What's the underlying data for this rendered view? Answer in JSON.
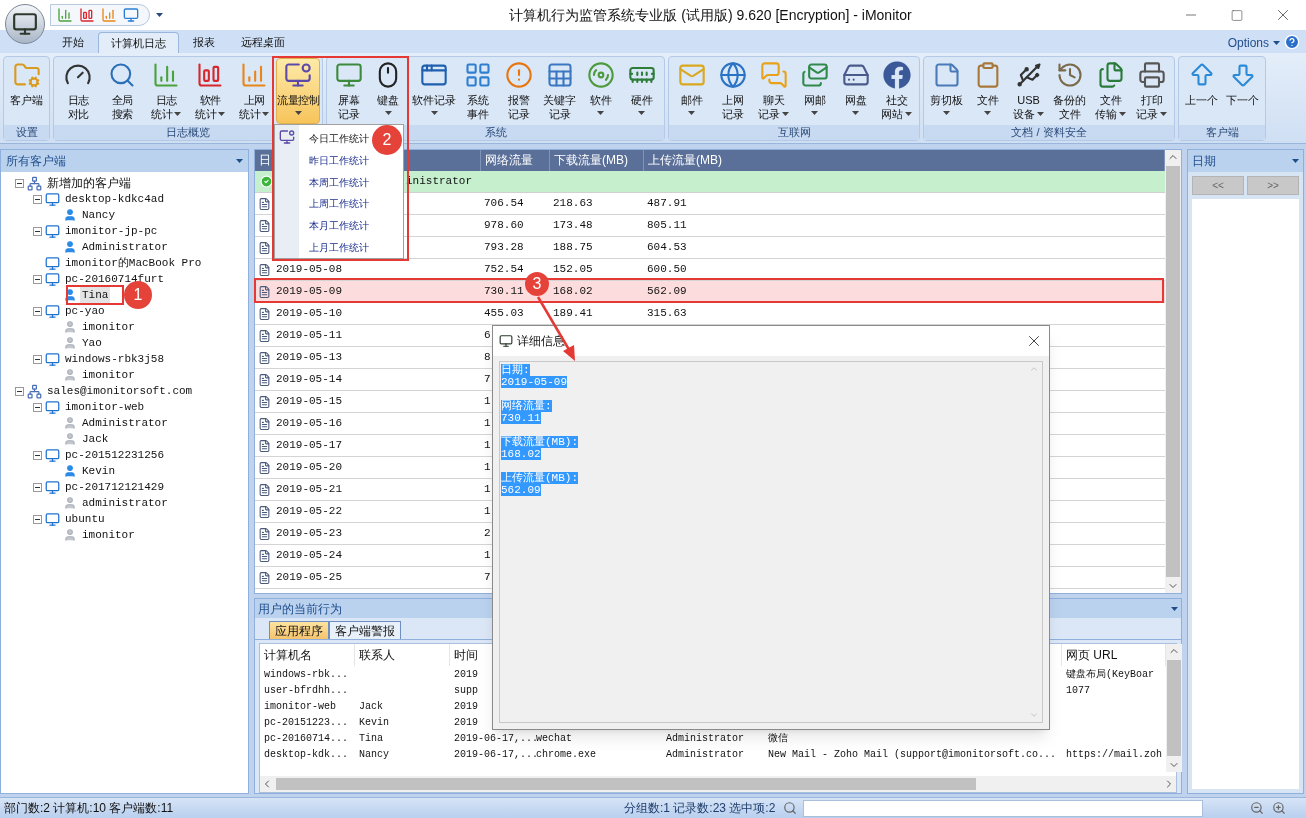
{
  "window": {
    "title": "计算机行为监管系统专业版 (试用版) 9.620 [Encryption] - iMonitor"
  },
  "ribbon_tabs": [
    {
      "label": "开始",
      "selected": false
    },
    {
      "label": "计算机日志",
      "selected": true
    },
    {
      "label": "报表",
      "selected": false
    },
    {
      "label": "远程桌面",
      "selected": false
    }
  ],
  "options": "Options",
  "ribbon_groups": [
    {
      "label": "设置",
      "buttons": [
        {
          "lines": [
            "客户端"
          ],
          "dropdown": false,
          "pressed": false
        }
      ]
    },
    {
      "label": "日志概览",
      "buttons": [
        {
          "lines": [
            "日志",
            "对比"
          ],
          "dropdown": false,
          "pressed": false
        },
        {
          "lines": [
            "全局",
            "搜索"
          ],
          "dropdown": false,
          "pressed": false
        },
        {
          "lines": [
            "日志",
            "统计"
          ],
          "dropdown": true,
          "pressed": false
        },
        {
          "lines": [
            "软件",
            "统计"
          ],
          "dropdown": true,
          "pressed": false
        },
        {
          "lines": [
            "上网",
            "统计"
          ],
          "dropdown": true,
          "pressed": false
        },
        {
          "lines": [
            "流量控制"
          ],
          "dropdown": true,
          "pressed": true
        }
      ]
    },
    {
      "label": "系统",
      "buttons": [
        {
          "lines": [
            "屏幕",
            "记录"
          ],
          "dropdown": false,
          "pressed": false
        },
        {
          "lines": [
            "键盘"
          ],
          "dropdown": true,
          "pressed": false
        },
        {
          "lines": [
            "软件记录"
          ],
          "dropdown": true,
          "pressed": false
        },
        {
          "lines": [
            "系统",
            "事件"
          ],
          "dropdown": false,
          "pressed": false
        },
        {
          "lines": [
            "报警",
            "记录"
          ],
          "dropdown": false,
          "pressed": false
        },
        {
          "lines": [
            "关键字",
            "记录"
          ],
          "dropdown": false,
          "pressed": false
        },
        {
          "lines": [
            "软件"
          ],
          "dropdown": true,
          "pressed": false
        },
        {
          "lines": [
            "硬件"
          ],
          "dropdown": true,
          "pressed": false
        }
      ]
    },
    {
      "label": "互联网",
      "buttons": [
        {
          "lines": [
            "邮件"
          ],
          "dropdown": true,
          "pressed": false
        },
        {
          "lines": [
            "上网",
            "记录"
          ],
          "dropdown": false,
          "pressed": false
        },
        {
          "lines": [
            "聊天",
            "记录"
          ],
          "dropdown": true,
          "pressed": false
        },
        {
          "lines": [
            "网邮"
          ],
          "dropdown": true,
          "pressed": false
        },
        {
          "lines": [
            "网盘"
          ],
          "dropdown": true,
          "pressed": false
        },
        {
          "lines": [
            "社交",
            "网站"
          ],
          "dropdown": true,
          "pressed": false
        }
      ]
    },
    {
      "label": "文档 / 资料安全",
      "buttons": [
        {
          "lines": [
            "剪切板"
          ],
          "dropdown": true,
          "pressed": false
        },
        {
          "lines": [
            "文件"
          ],
          "dropdown": true,
          "pressed": false
        },
        {
          "lines": [
            "USB",
            "设备"
          ],
          "dropdown": true,
          "pressed": false
        },
        {
          "lines": [
            "备份的",
            "文件"
          ],
          "dropdown": false,
          "pressed": false
        },
        {
          "lines": [
            "文件",
            "传输"
          ],
          "dropdown": true,
          "pressed": false
        },
        {
          "lines": [
            "打印",
            "记录"
          ],
          "dropdown": true,
          "pressed": false
        }
      ]
    },
    {
      "label": "客户端",
      "buttons": [
        {
          "lines": [
            "上一个"
          ],
          "dropdown": false,
          "pressed": false
        },
        {
          "lines": [
            "下一个"
          ],
          "dropdown": false,
          "pressed": false
        }
      ]
    }
  ],
  "traffic_menu": {
    "items": [
      "今日工作统计",
      "昨日工作统计",
      "本周工作统计",
      "上周工作统计",
      "本月工作统计",
      "上月工作统计"
    ]
  },
  "left_panel": {
    "title": "所有客户端",
    "tree": [
      {
        "kind": "group",
        "label": "新增加的客户端",
        "expanded": true,
        "selected": false,
        "children": [
          {
            "kind": "computer",
            "label": "desktop-kdkc4ad",
            "expanded": true,
            "selected": false,
            "children": [
              {
                "kind": "user",
                "label": "Nancy",
                "online": true,
                "selected": false
              }
            ]
          },
          {
            "kind": "computer",
            "label": "imonitor-jp-pc",
            "expanded": true,
            "selected": false,
            "children": [
              {
                "kind": "user",
                "label": "Administrator",
                "online": true,
                "selected": false
              }
            ]
          },
          {
            "kind": "computer",
            "label": "imonitor的MacBook Pro",
            "selected": false
          },
          {
            "kind": "computer",
            "label": "pc-20160714furt",
            "expanded": true,
            "selected": false,
            "children": [
              {
                "kind": "user",
                "label": "Tina",
                "online": true,
                "selected": true
              }
            ]
          },
          {
            "kind": "computer",
            "label": "pc-yao",
            "expanded": true,
            "selected": false,
            "children": [
              {
                "kind": "user",
                "label": "imonitor",
                "online": false,
                "selected": false
              },
              {
                "kind": "user",
                "label": "Yao",
                "online": false,
                "selected": false
              }
            ]
          },
          {
            "kind": "computer",
            "label": "windows-rbk3j58",
            "expanded": true,
            "selected": false,
            "children": [
              {
                "kind": "user",
                "label": "imonitor",
                "online": false,
                "selected": false
              }
            ]
          }
        ]
      },
      {
        "kind": "group",
        "label": "sales@imonitorsoft.com",
        "expanded": true,
        "selected": false,
        "children": [
          {
            "kind": "computer",
            "label": "imonitor-web",
            "expanded": true,
            "selected": false,
            "children": [
              {
                "kind": "user",
                "label": "Administrator",
                "online": false,
                "selected": false
              },
              {
                "kind": "user",
                "label": "Jack",
                "online": false,
                "selected": false
              }
            ]
          },
          {
            "kind": "computer",
            "label": "pc-201512231256",
            "expanded": true,
            "selected": false,
            "children": [
              {
                "kind": "user",
                "label": "Kevin",
                "online": true,
                "selected": false
              }
            ]
          },
          {
            "kind": "computer",
            "label": "pc-201712121429",
            "expanded": true,
            "selected": false,
            "children": [
              {
                "kind": "user",
                "label": "administrator",
                "online": false,
                "selected": false
              }
            ]
          },
          {
            "kind": "computer",
            "label": "ubuntu",
            "expanded": true,
            "selected": false,
            "children": [
              {
                "kind": "user",
                "label": "imonitor",
                "online": false,
                "selected": false
              }
            ]
          }
        ]
      }
    ]
  },
  "table": {
    "columns": [
      "日",
      "网络流量",
      "下载流量(MB)",
      "上传流量(MB)"
    ],
    "group_row": "inistrator",
    "rows": [
      {
        "network": "706.54",
        "download": "218.63",
        "upload": "487.91",
        "selected": false
      },
      {
        "network": "978.60",
        "download": "173.48",
        "upload": "805.11",
        "selected": false
      },
      {
        "network": "793.28",
        "download": "188.75",
        "upload": "604.53",
        "selected": false
      },
      {
        "date": "2019-05-08",
        "network": "752.54",
        "download": "152.05",
        "upload": "600.50",
        "selected": false
      },
      {
        "date": "2019-05-09",
        "network": "730.11",
        "download": "168.02",
        "upload": "562.09",
        "selected": true
      },
      {
        "date": "2019-05-10",
        "network": "455.03",
        "download": "189.41",
        "upload": "315.63",
        "selected": false
      },
      {
        "date": "2019-05-11",
        "network": "6",
        "selected": false
      },
      {
        "date": "2019-05-13",
        "network": "8",
        "selected": false
      },
      {
        "date": "2019-05-14",
        "network": "7",
        "selected": false
      },
      {
        "date": "2019-05-15",
        "network": "1",
        "selected": false
      },
      {
        "date": "2019-05-16",
        "network": "1",
        "selected": false
      },
      {
        "date": "2019-05-17",
        "network": "1",
        "selected": false
      },
      {
        "date": "2019-05-20",
        "network": "1",
        "selected": false
      },
      {
        "date": "2019-05-21",
        "network": "1",
        "selected": false
      },
      {
        "date": "2019-05-22",
        "network": "1",
        "selected": false
      },
      {
        "date": "2019-05-23",
        "network": "2",
        "selected": false
      },
      {
        "date": "2019-05-24",
        "network": "1",
        "selected": false
      },
      {
        "date": "2019-05-25",
        "network": "7",
        "selected": false
      }
    ]
  },
  "activity_panel": {
    "title": "用户的当前行为",
    "tabs": [
      {
        "label": "应用程序",
        "selected": true
      },
      {
        "label": "客户端警报",
        "selected": false
      }
    ],
    "columns": {
      "computer": "计算机名",
      "contact": "联系人",
      "time": "时间",
      "url": "网页 URL"
    },
    "rows": [
      {
        "computer": "windows-rbk...",
        "time": "2019",
        "url": "键盘布局(KeyBoar"
      },
      {
        "computer": "user-bfrdhh...",
        "time": "supp",
        "url": "1077"
      },
      {
        "computer": "imonitor-web",
        "contact": "Jack",
        "time": "2019"
      },
      {
        "computer": "pc-20151223...",
        "contact": "Kevin",
        "time": "2019"
      },
      {
        "computer": "pc-20160714...",
        "contact": "Tina",
        "time": "2019-06-17,...",
        "column_4": "wechat",
        "column_5": "Administrator",
        "column_6": "微信"
      },
      {
        "computer": "desktop-kdk...",
        "contact": "Nancy",
        "time": "2019-06-17,...",
        "column_4": "chrome.exe",
        "column_5": "Administrator",
        "column_6": "New Mail - Zoho Mail (support@imonitorsoft.co...",
        "url": "https://mail.zoh"
      }
    ]
  },
  "date_panel": {
    "title": "日期",
    "prev": "<<",
    "next": ">>"
  },
  "detail_dialog": {
    "title": "详细信息",
    "fields": [
      {
        "label": "日期:",
        "value": "2019-05-09"
      },
      {
        "label": "网络流量:",
        "value": "730.11"
      },
      {
        "label": "下载流量(MB):",
        "value": "168.02"
      },
      {
        "label": "上传流量(MB):",
        "value": "562.09"
      }
    ]
  },
  "annotations": [
    "1",
    "2",
    "3"
  ],
  "status_bar": {
    "left": "部门数:2 计算机:10 客户端数:11",
    "right": "分组数:1 记录数:23 选中项:2"
  }
}
